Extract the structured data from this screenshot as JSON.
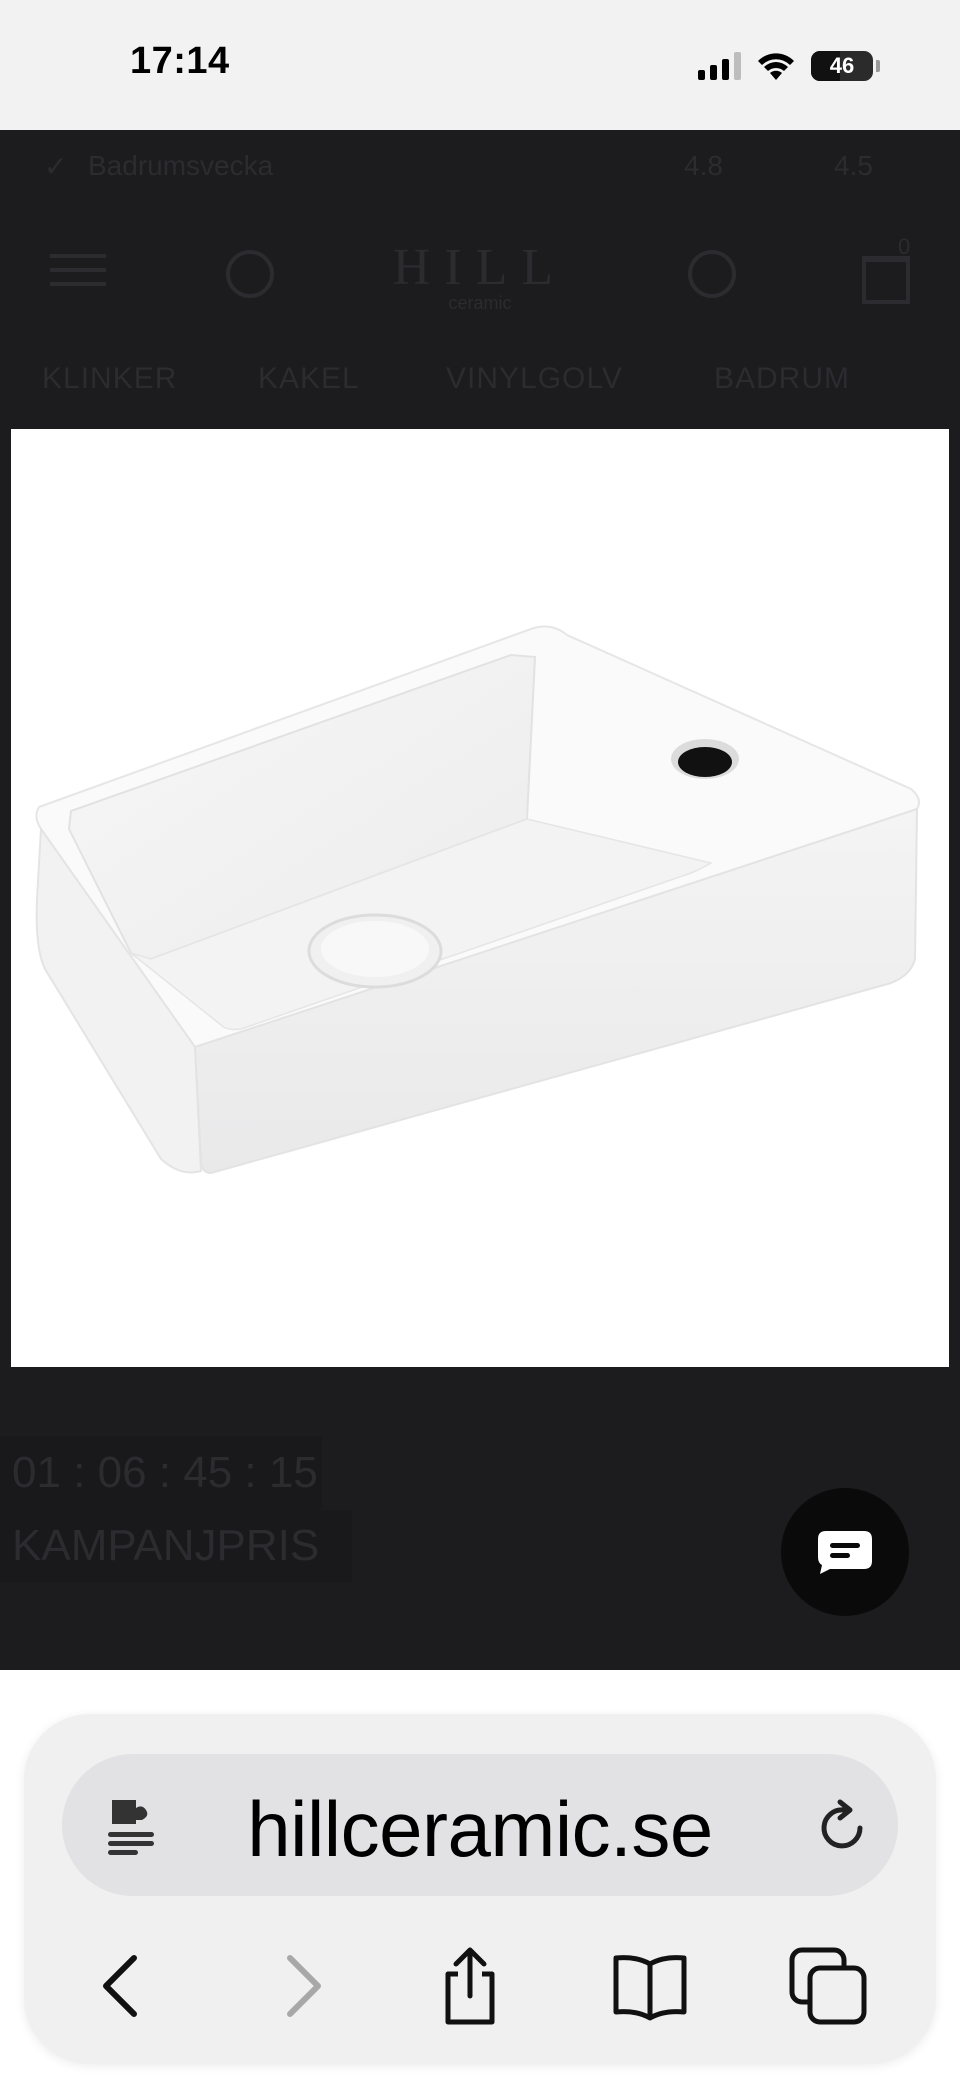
{
  "status_bar": {
    "time": "17:14",
    "battery": "46"
  },
  "site": {
    "topbar": {
      "usp": "Badrumsvecka",
      "rating_1": "4.8",
      "rating_2": "4.5"
    },
    "logo": {
      "main": "HILL",
      "sub": "ceramic"
    },
    "cart_count": "0",
    "nav": [
      "KLINKER",
      "KAKEL",
      "VINYLGOLV",
      "BADRUM"
    ],
    "product_image": {
      "description_icon": "sink-product-image"
    },
    "timer": "01 : 06 : 45 : 15",
    "campaign_label": "KAMPANJPRIS"
  },
  "browser": {
    "url": "hillceramic.se"
  },
  "colors": {
    "overlay": "#1c1c1f",
    "safari_panel": "#f0f0f1",
    "url_bar": "#e2e2e4"
  }
}
